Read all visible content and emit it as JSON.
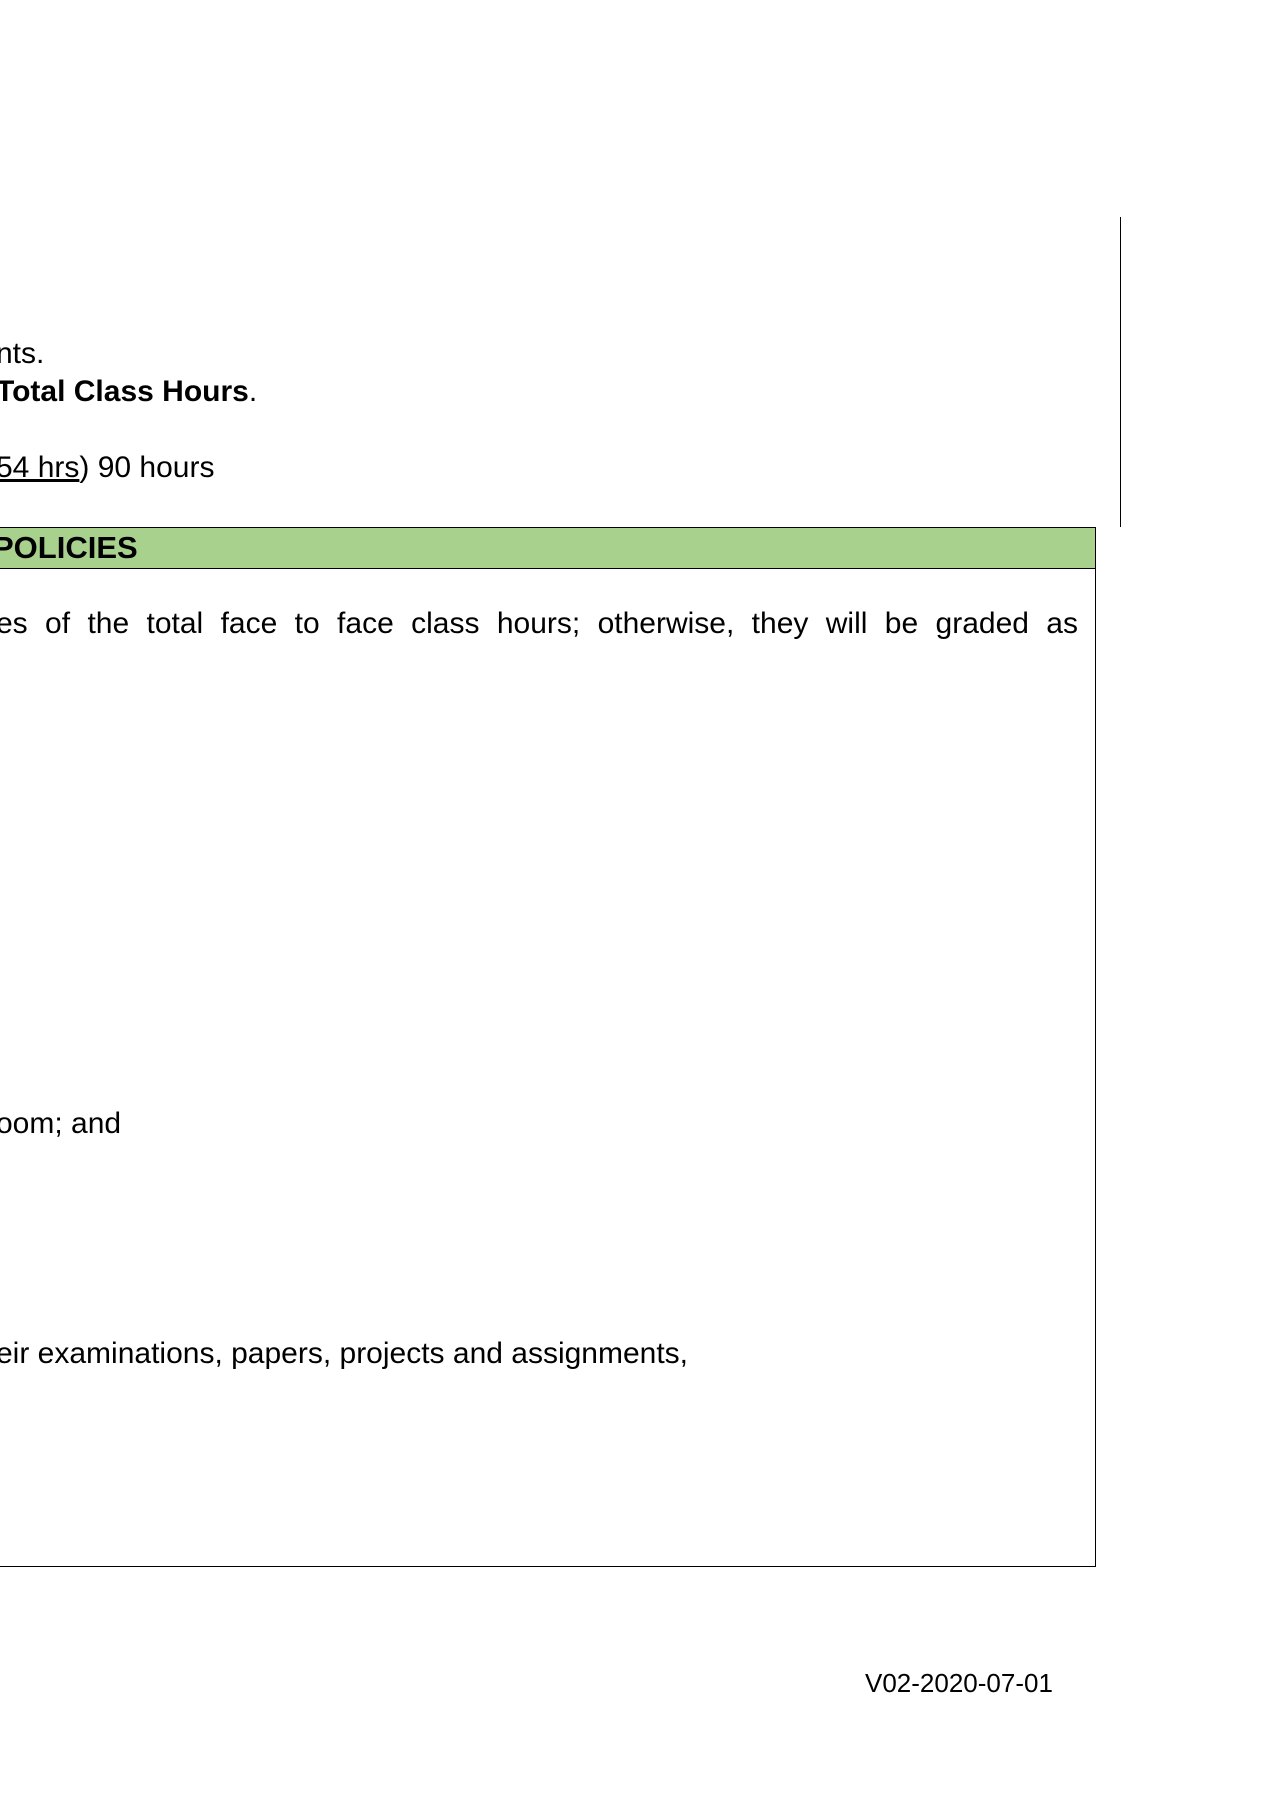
{
  "lines": {
    "l1": "nts.",
    "l2_bold": "Total Class Hours",
    "l2_tail": ".",
    "l3_underlined": "54 hrs",
    "l3_tail": ") 90 hours"
  },
  "policies_box": {
    "header": "POLICIES",
    "p1": "es of the total face to face class hours; otherwise, they will be graded as",
    "p2": "oom; and",
    "p3": "eir examinations, papers, projects and assignments,"
  },
  "footer": {
    "version": "V02-2020-07-01"
  }
}
